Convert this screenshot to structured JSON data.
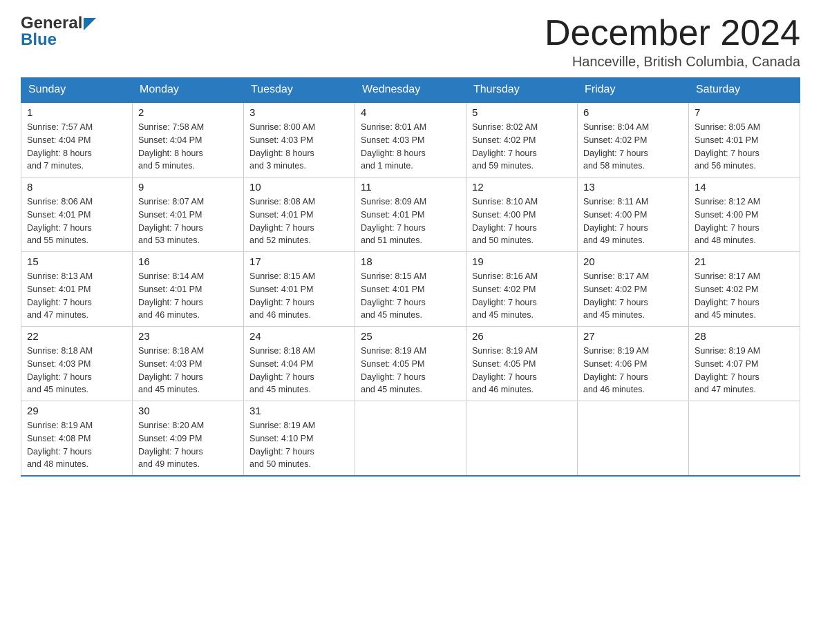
{
  "logo": {
    "general": "General",
    "blue": "Blue",
    "arrow_color": "#1a6faf"
  },
  "header": {
    "title": "December 2024",
    "location": "Hanceville, British Columbia, Canada"
  },
  "weekdays": [
    "Sunday",
    "Monday",
    "Tuesday",
    "Wednesday",
    "Thursday",
    "Friday",
    "Saturday"
  ],
  "weeks": [
    [
      {
        "day": "1",
        "info": "Sunrise: 7:57 AM\nSunset: 4:04 PM\nDaylight: 8 hours\nand 7 minutes."
      },
      {
        "day": "2",
        "info": "Sunrise: 7:58 AM\nSunset: 4:04 PM\nDaylight: 8 hours\nand 5 minutes."
      },
      {
        "day": "3",
        "info": "Sunrise: 8:00 AM\nSunset: 4:03 PM\nDaylight: 8 hours\nand 3 minutes."
      },
      {
        "day": "4",
        "info": "Sunrise: 8:01 AM\nSunset: 4:03 PM\nDaylight: 8 hours\nand 1 minute."
      },
      {
        "day": "5",
        "info": "Sunrise: 8:02 AM\nSunset: 4:02 PM\nDaylight: 7 hours\nand 59 minutes."
      },
      {
        "day": "6",
        "info": "Sunrise: 8:04 AM\nSunset: 4:02 PM\nDaylight: 7 hours\nand 58 minutes."
      },
      {
        "day": "7",
        "info": "Sunrise: 8:05 AM\nSunset: 4:01 PM\nDaylight: 7 hours\nand 56 minutes."
      }
    ],
    [
      {
        "day": "8",
        "info": "Sunrise: 8:06 AM\nSunset: 4:01 PM\nDaylight: 7 hours\nand 55 minutes."
      },
      {
        "day": "9",
        "info": "Sunrise: 8:07 AM\nSunset: 4:01 PM\nDaylight: 7 hours\nand 53 minutes."
      },
      {
        "day": "10",
        "info": "Sunrise: 8:08 AM\nSunset: 4:01 PM\nDaylight: 7 hours\nand 52 minutes."
      },
      {
        "day": "11",
        "info": "Sunrise: 8:09 AM\nSunset: 4:01 PM\nDaylight: 7 hours\nand 51 minutes."
      },
      {
        "day": "12",
        "info": "Sunrise: 8:10 AM\nSunset: 4:00 PM\nDaylight: 7 hours\nand 50 minutes."
      },
      {
        "day": "13",
        "info": "Sunrise: 8:11 AM\nSunset: 4:00 PM\nDaylight: 7 hours\nand 49 minutes."
      },
      {
        "day": "14",
        "info": "Sunrise: 8:12 AM\nSunset: 4:00 PM\nDaylight: 7 hours\nand 48 minutes."
      }
    ],
    [
      {
        "day": "15",
        "info": "Sunrise: 8:13 AM\nSunset: 4:01 PM\nDaylight: 7 hours\nand 47 minutes."
      },
      {
        "day": "16",
        "info": "Sunrise: 8:14 AM\nSunset: 4:01 PM\nDaylight: 7 hours\nand 46 minutes."
      },
      {
        "day": "17",
        "info": "Sunrise: 8:15 AM\nSunset: 4:01 PM\nDaylight: 7 hours\nand 46 minutes."
      },
      {
        "day": "18",
        "info": "Sunrise: 8:15 AM\nSunset: 4:01 PM\nDaylight: 7 hours\nand 45 minutes."
      },
      {
        "day": "19",
        "info": "Sunrise: 8:16 AM\nSunset: 4:02 PM\nDaylight: 7 hours\nand 45 minutes."
      },
      {
        "day": "20",
        "info": "Sunrise: 8:17 AM\nSunset: 4:02 PM\nDaylight: 7 hours\nand 45 minutes."
      },
      {
        "day": "21",
        "info": "Sunrise: 8:17 AM\nSunset: 4:02 PM\nDaylight: 7 hours\nand 45 minutes."
      }
    ],
    [
      {
        "day": "22",
        "info": "Sunrise: 8:18 AM\nSunset: 4:03 PM\nDaylight: 7 hours\nand 45 minutes."
      },
      {
        "day": "23",
        "info": "Sunrise: 8:18 AM\nSunset: 4:03 PM\nDaylight: 7 hours\nand 45 minutes."
      },
      {
        "day": "24",
        "info": "Sunrise: 8:18 AM\nSunset: 4:04 PM\nDaylight: 7 hours\nand 45 minutes."
      },
      {
        "day": "25",
        "info": "Sunrise: 8:19 AM\nSunset: 4:05 PM\nDaylight: 7 hours\nand 45 minutes."
      },
      {
        "day": "26",
        "info": "Sunrise: 8:19 AM\nSunset: 4:05 PM\nDaylight: 7 hours\nand 46 minutes."
      },
      {
        "day": "27",
        "info": "Sunrise: 8:19 AM\nSunset: 4:06 PM\nDaylight: 7 hours\nand 46 minutes."
      },
      {
        "day": "28",
        "info": "Sunrise: 8:19 AM\nSunset: 4:07 PM\nDaylight: 7 hours\nand 47 minutes."
      }
    ],
    [
      {
        "day": "29",
        "info": "Sunrise: 8:19 AM\nSunset: 4:08 PM\nDaylight: 7 hours\nand 48 minutes."
      },
      {
        "day": "30",
        "info": "Sunrise: 8:20 AM\nSunset: 4:09 PM\nDaylight: 7 hours\nand 49 minutes."
      },
      {
        "day": "31",
        "info": "Sunrise: 8:19 AM\nSunset: 4:10 PM\nDaylight: 7 hours\nand 50 minutes."
      },
      {
        "day": "",
        "info": ""
      },
      {
        "day": "",
        "info": ""
      },
      {
        "day": "",
        "info": ""
      },
      {
        "day": "",
        "info": ""
      }
    ]
  ]
}
